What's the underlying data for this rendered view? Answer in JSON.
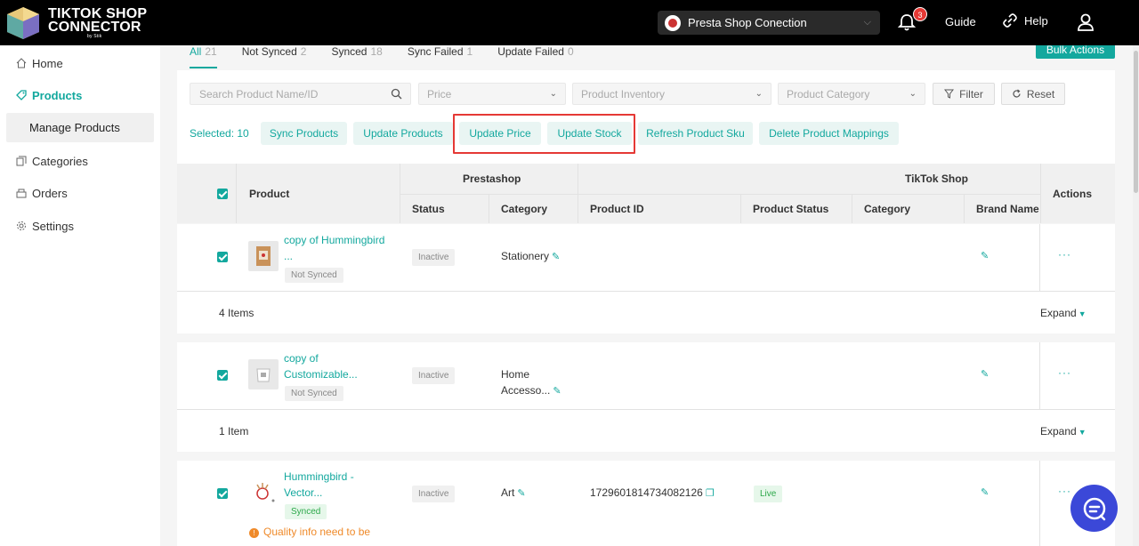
{
  "app": {
    "logo_line1": "TIKTOK SHOP",
    "logo_line2": "CONNECTOR",
    "logo_sub": "by Stik"
  },
  "topbar": {
    "store": "Presta Shop Conection",
    "notification_count": "3",
    "guide": "Guide",
    "help": "Help"
  },
  "sidebar": {
    "home": "Home",
    "products": "Products",
    "manage_products": "Manage Products",
    "categories": "Categories",
    "orders": "Orders",
    "settings": "Settings"
  },
  "tabs": [
    {
      "label": "All",
      "count": "21"
    },
    {
      "label": "Not Synced",
      "count": "2"
    },
    {
      "label": "Synced",
      "count": "18"
    },
    {
      "label": "Sync Failed",
      "count": "1"
    },
    {
      "label": "Update Failed",
      "count": "0"
    }
  ],
  "bulk_actions": "Bulk Actions",
  "filters": {
    "search_placeholder": "Search Product Name/ID",
    "price": "Price",
    "inventory": "Product Inventory",
    "category": "Product Category",
    "filter": "Filter",
    "reset": "Reset"
  },
  "selection": {
    "selected": "Selected: 10",
    "actions": [
      "Sync Products",
      "Update Products",
      "Update Price",
      "Update Stock",
      "Refresh Product Sku",
      "Delete Product Mappings"
    ]
  },
  "table": {
    "product": "Product",
    "prestashop": "Prestashop",
    "tiktok": "TikTok Shop",
    "actions": "Actions",
    "status": "Status",
    "category": "Category",
    "product_id": "Product ID",
    "product_status": "Product Status",
    "tt_category": "Category",
    "brand": "Brand Name"
  },
  "rows": [
    {
      "name_l1": "copy of Hummingbird",
      "name_l2": "...",
      "sync_tag": "Not Synced",
      "status": "Inactive",
      "category": "Stationery",
      "items": "4 Items",
      "expand": "Expand"
    },
    {
      "name_l1": "copy of",
      "name_l2": "Customizable...",
      "sync_tag": "Not Synced",
      "status": "Inactive",
      "category_l1": "Home",
      "category_l2": "Accesso...",
      "items": "1 Item",
      "expand": "Expand"
    },
    {
      "name_l1": "Hummingbird -",
      "name_l2": "Vector...",
      "sync_tag": "Synced",
      "status": "Inactive",
      "category": "Art",
      "product_id": "1729601814734082126",
      "product_status": "Live",
      "warning": "Quality info need to be"
    }
  ],
  "colors": {
    "accent": "#13a89e",
    "highlight": "#e53935",
    "fab": "#3b48d8"
  }
}
